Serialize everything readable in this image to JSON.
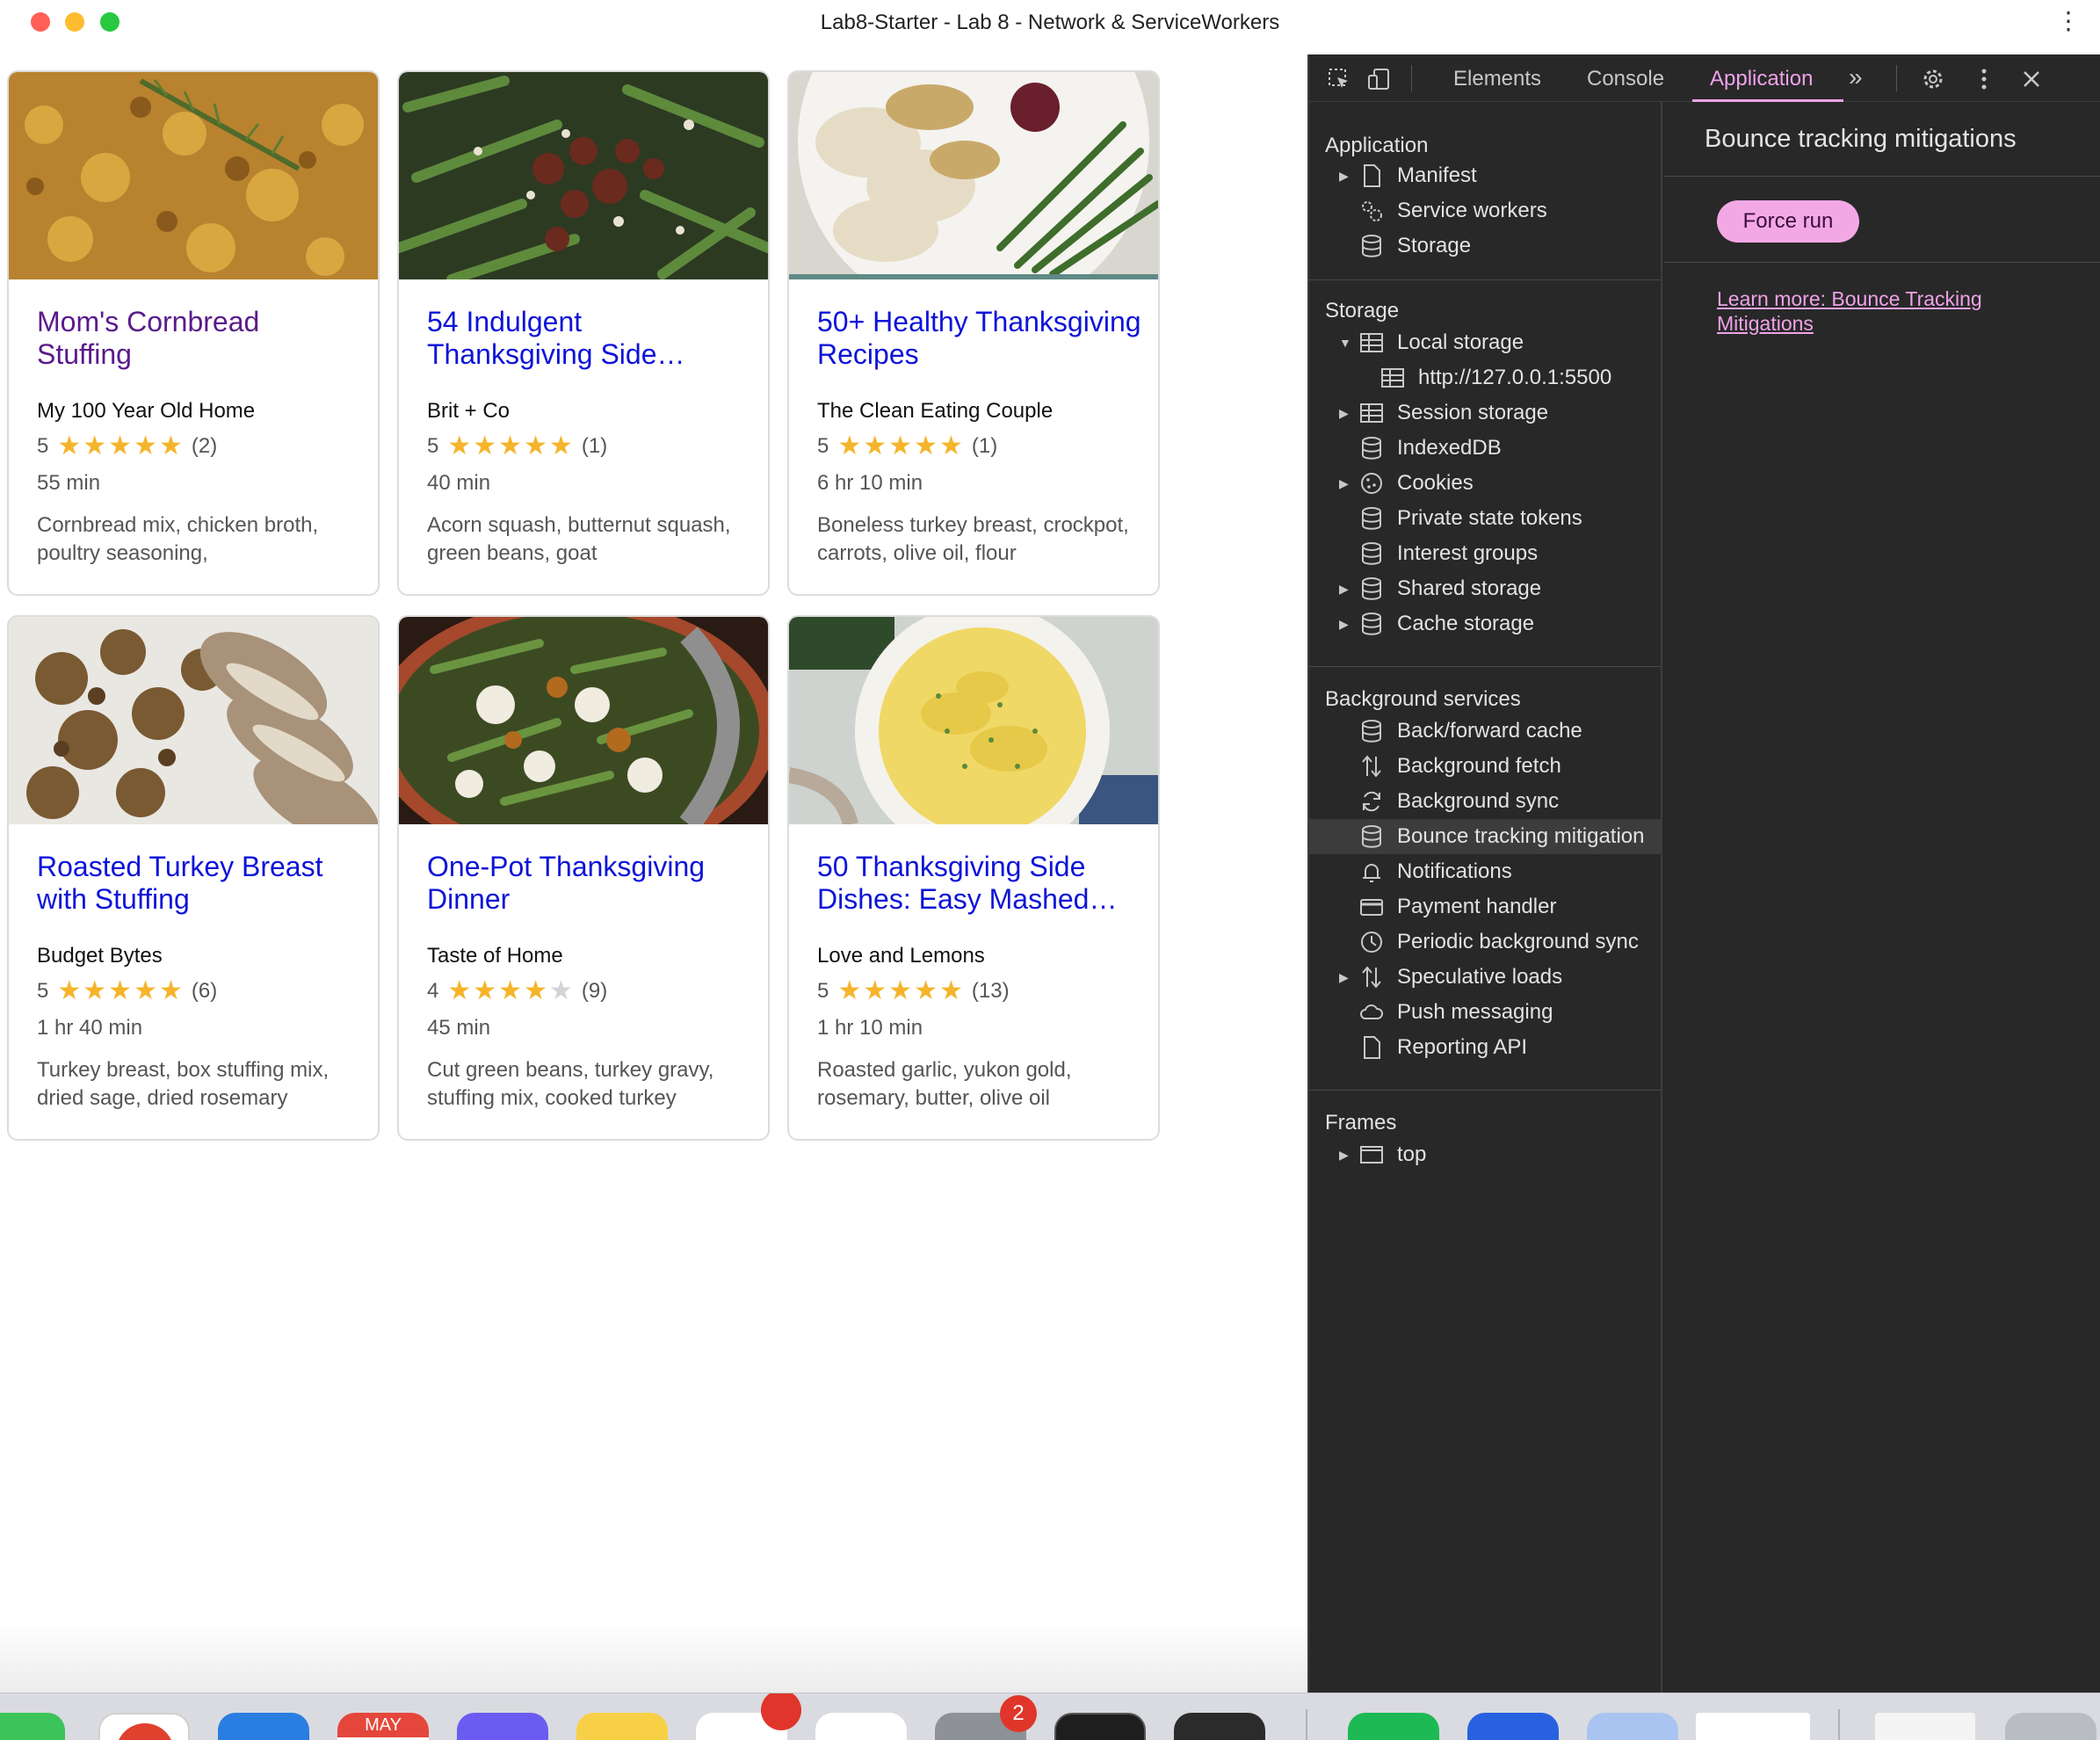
{
  "window": {
    "title": "Lab8-Starter - Lab 8 - Network & ServiceWorkers",
    "menu_icon": "kebab-icon"
  },
  "recipes": [
    {
      "title": "Mom's Cornbread Stuffing",
      "visited": true,
      "source": "My 100 Year Old Home",
      "rating": 5,
      "stars": "★★★★★",
      "reviews": "(2)",
      "time": "55 min",
      "ingredients": "Cornbread mix, chicken broth, poultry seasoning,"
    },
    {
      "title": "54 Indulgent Thanksgiving Side…",
      "visited": false,
      "source": "Brit + Co",
      "rating": 5,
      "stars": "★★★★★",
      "reviews": "(1)",
      "time": "40 min",
      "ingredients": "Acorn squash, butternut squash, green beans, goat"
    },
    {
      "title": "50+ Healthy Thanksgiving Recipes",
      "visited": false,
      "source": "The Clean Eating Couple",
      "rating": 5,
      "stars": "★★★★★",
      "reviews": "(1)",
      "time": "6 hr 10 min",
      "ingredients": "Boneless turkey breast, crockpot, carrots, olive oil, flour"
    },
    {
      "title": "Roasted Turkey Breast with Stuffing",
      "visited": false,
      "source": "Budget Bytes",
      "rating": 5,
      "stars": "★★★★★",
      "reviews": "(6)",
      "time": "1 hr 40 min",
      "ingredients": "Turkey breast, box stuffing mix, dried sage, dried rosemary"
    },
    {
      "title": "One-Pot Thanksgiving Dinner",
      "visited": false,
      "source": "Taste of Home",
      "rating": 4,
      "stars": "★★★★★",
      "reviews": "(9)",
      "time": "45 min",
      "ingredients": "Cut green beans, turkey gravy, stuffing mix, cooked turkey"
    },
    {
      "title": "50 Thanksgiving Side Dishes: Easy Mashed…",
      "visited": false,
      "source": "Love and Lemons",
      "rating": 5,
      "stars": "★★★★★",
      "reviews": "(13)",
      "time": "1 hr 10 min",
      "ingredients": "Roasted garlic, yukon gold, rosemary, butter, olive oil"
    }
  ],
  "devtools": {
    "tabs": {
      "elements": "Elements",
      "console": "Console",
      "application": "Application",
      "more": "»"
    },
    "sidebar": {
      "application_head": "Application",
      "manifest": "Manifest",
      "service_workers": "Service workers",
      "storage_item": "Storage",
      "storage_head": "Storage",
      "local_storage": "Local storage",
      "local_origin": "http://127.0.0.1:5500",
      "session_storage": "Session storage",
      "indexeddb": "IndexedDB",
      "cookies": "Cookies",
      "private_state_tokens": "Private state tokens",
      "interest_groups": "Interest groups",
      "shared_storage": "Shared storage",
      "cache_storage": "Cache storage",
      "background_head": "Background services",
      "bfcache": "Back/forward cache",
      "bg_fetch": "Background fetch",
      "bg_sync": "Background sync",
      "bounce": "Bounce tracking mitigation",
      "notifications": "Notifications",
      "payment": "Payment handler",
      "periodic_sync": "Periodic background sync",
      "speculative": "Speculative loads",
      "push": "Push messaging",
      "reporting": "Reporting API",
      "frames_head": "Frames",
      "top": "top"
    },
    "main": {
      "title": "Bounce tracking mitigations",
      "force_run": "Force run",
      "learn_more": "Learn more: Bounce Tracking Mitigations"
    }
  },
  "dock": {
    "calendar_month": "MAY",
    "badge_settings": "2"
  },
  "colors": {
    "link": "#0d14d8",
    "visited_link": "#5a1a8c",
    "star": "#f5b42a",
    "devtools_bg": "#282828",
    "devtools_accent": "#f0a2e8"
  }
}
